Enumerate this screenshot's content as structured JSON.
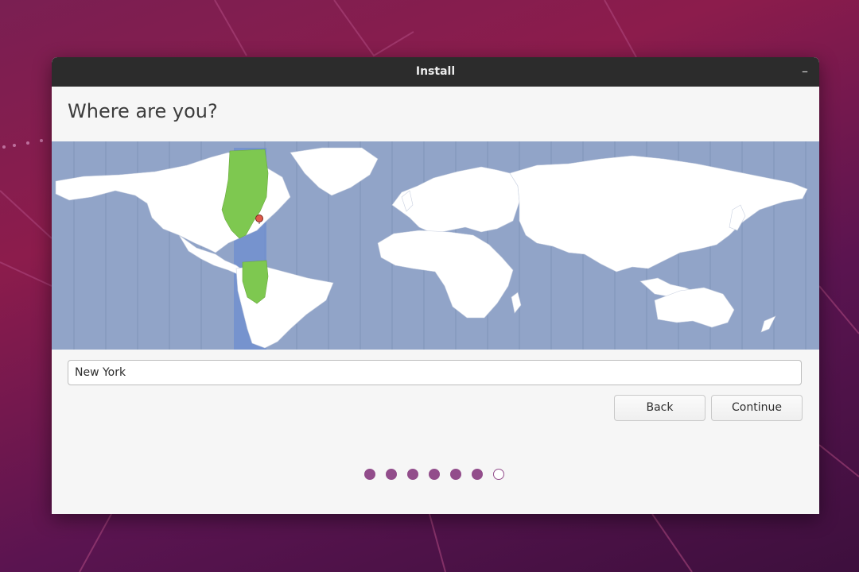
{
  "window": {
    "title": "Install",
    "minimize_glyph": "–"
  },
  "page": {
    "heading": "Where are you?"
  },
  "location": {
    "value": "New York",
    "selected_city": "New York",
    "timezone_highlight_color": "#7ec850"
  },
  "buttons": {
    "back": "Back",
    "continue": "Continue"
  },
  "progress": {
    "total_steps": 7,
    "current_step": 7,
    "dot_color": "#924d8b"
  },
  "colors": {
    "titlebar": "#2c2c2c",
    "ocean": "#91a4c8",
    "land": "#ffffff",
    "desktop": "#7a1f52"
  },
  "icons": {
    "location_pin": "map-pin-icon",
    "minimize": "minimize-icon"
  }
}
